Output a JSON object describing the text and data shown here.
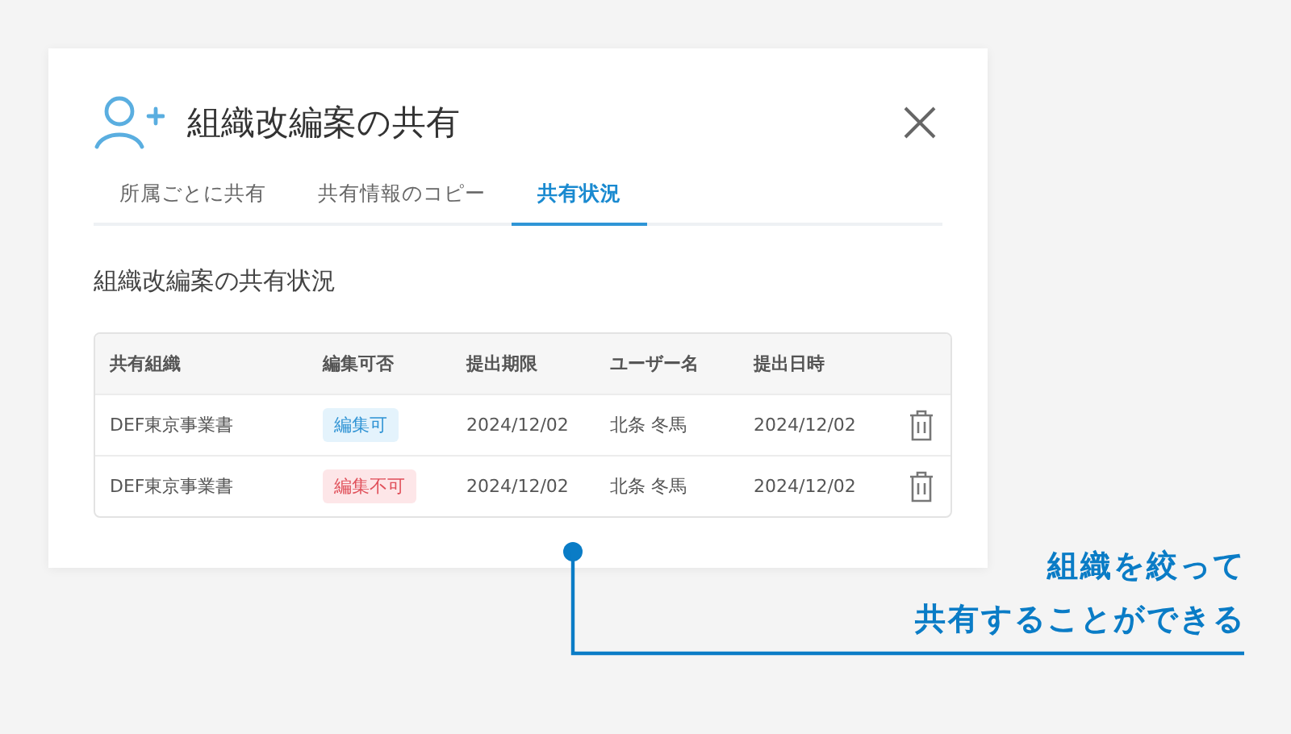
{
  "dialog": {
    "title": "組織改編案の共有",
    "tabs": [
      {
        "label": "所属ごとに共有",
        "selected": false
      },
      {
        "label": "共有情報のコピー",
        "selected": false
      },
      {
        "label": "共有状況",
        "selected": true
      }
    ],
    "section_title": "組織改編案の共有状況",
    "table": {
      "columns": [
        "共有組織",
        "編集可否",
        "提出期限",
        "ユーザー名",
        "提出日時"
      ],
      "rows": [
        {
          "organization": "DEF東京事業書",
          "permission": {
            "label": "編集可",
            "editable": true
          },
          "deadline": "2024/12/02",
          "user": "北条 冬馬",
          "submitted": "2024/12/02"
        },
        {
          "organization": "DEF東京事業書",
          "permission": {
            "label": "編集不可",
            "editable": false
          },
          "deadline": "2024/12/02",
          "user": "北条 冬馬",
          "submitted": "2024/12/02"
        }
      ]
    }
  },
  "callout": {
    "lines": [
      "組織を絞って",
      "共有することができる"
    ]
  }
}
